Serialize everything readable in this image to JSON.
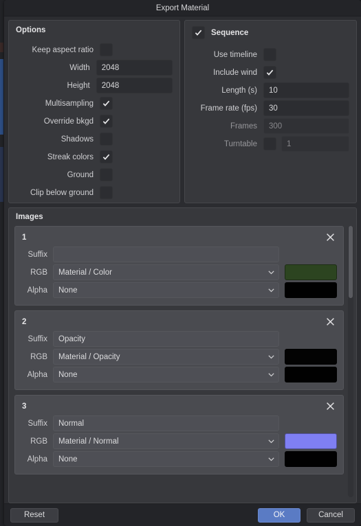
{
  "window": {
    "title": "Export Material"
  },
  "options": {
    "title": "Options",
    "rows": [
      {
        "label": "Keep aspect ratio",
        "type": "checkbox",
        "checked": false
      },
      {
        "label": "Width",
        "type": "text",
        "value": "2048"
      },
      {
        "label": "Height",
        "type": "text",
        "value": "2048"
      },
      {
        "label": "Multisampling",
        "type": "checkbox",
        "checked": true
      },
      {
        "label": "Override bkgd",
        "type": "checkbox",
        "checked": true
      },
      {
        "label": "Shadows",
        "type": "checkbox",
        "checked": false
      },
      {
        "label": "Streak colors",
        "type": "checkbox",
        "checked": true
      },
      {
        "label": "Ground",
        "type": "checkbox",
        "checked": false
      },
      {
        "label": "Clip below ground",
        "type": "checkbox",
        "checked": false
      }
    ]
  },
  "sequence": {
    "title": "Sequence",
    "enabled": true,
    "rows": [
      {
        "label": "Use timeline",
        "type": "checkbox",
        "checked": false
      },
      {
        "label": "Include wind",
        "type": "checkbox",
        "checked": true
      },
      {
        "label": "Length (s)",
        "type": "text",
        "value": "10",
        "disabled": false
      },
      {
        "label": "Frame rate (fps)",
        "type": "text",
        "value": "30",
        "disabled": false
      },
      {
        "label": "Frames",
        "type": "text",
        "value": "300",
        "disabled": true
      },
      {
        "label": "Turntable",
        "type": "checkbox-text",
        "checked": false,
        "value": "1",
        "disabled": true
      }
    ]
  },
  "images": {
    "title": "Images",
    "field_labels": {
      "suffix": "Suffix",
      "rgb": "RGB",
      "alpha": "Alpha"
    },
    "close_icon": "close-icon",
    "cards": [
      {
        "index": "1",
        "suffix": "",
        "rgb": "Material / Color",
        "rgb_color": "#2c4420",
        "alpha": "None",
        "alpha_color": "#010101"
      },
      {
        "index": "2",
        "suffix": "Opacity",
        "rgb": "Material / Opacity",
        "rgb_color": "#030303",
        "alpha": "None",
        "alpha_color": "#010101"
      },
      {
        "index": "3",
        "suffix": "Normal",
        "rgb": "Material / Normal",
        "rgb_color": "#7f7ff2",
        "alpha": "None",
        "alpha_color": "#010101"
      }
    ]
  },
  "footer": {
    "reset_label": "Reset",
    "ok_label": "OK",
    "cancel_label": "Cancel",
    "ok_color": "#5a7bc4"
  }
}
